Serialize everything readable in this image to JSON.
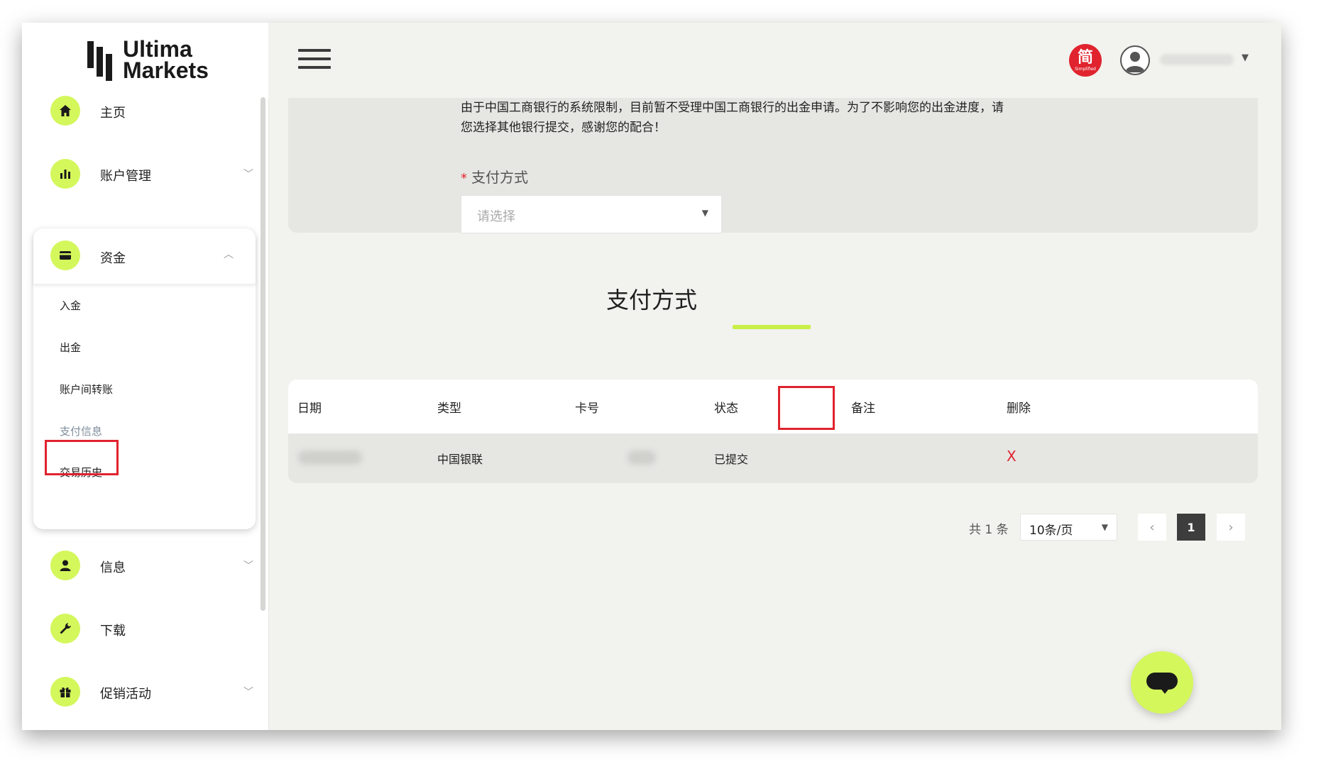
{
  "brand": {
    "line1": "Ultima",
    "line2": "Markets"
  },
  "sidebar": {
    "items": [
      {
        "label": "主页",
        "icon": "home-icon"
      },
      {
        "label": "账户管理",
        "icon": "bar-chart-icon"
      },
      {
        "label": "资金",
        "icon": "card-icon"
      },
      {
        "label": "信息",
        "icon": "user-icon"
      },
      {
        "label": "下载",
        "icon": "wrench-icon"
      },
      {
        "label": "促销活动",
        "icon": "gift-icon"
      }
    ],
    "funds_sub": [
      {
        "label": "入金"
      },
      {
        "label": "出金"
      },
      {
        "label": "账户间转账"
      },
      {
        "label": "支付信息",
        "active": true
      },
      {
        "label": "交易历史"
      }
    ]
  },
  "header": {
    "lang_badge": "简",
    "lang_badge_sub": "Simplified"
  },
  "form": {
    "notice_line1": "由于中国工商银行的系统限制，目前暂不受理中国工商银行的出金申请。为了不影响您的出金进度，请",
    "notice_line2": "您选择其他银行提交，感谢您的配合！",
    "required_mark": "*",
    "field_label": "支付方式",
    "select_placeholder": "请选择"
  },
  "section_title": "支付方式",
  "table": {
    "headers": [
      "日期",
      "类型",
      "卡号",
      "状态",
      "备注",
      "删除"
    ],
    "rows": [
      {
        "type": "中国银联",
        "status": "已提交",
        "remark": "",
        "delete": "X"
      }
    ]
  },
  "pagination": {
    "total": "共 1 条",
    "page_size": "10条/页",
    "current_page": "1",
    "prev": "‹",
    "next": "›"
  },
  "colors": {
    "accent": "#d4f75c",
    "highlight_box": "#e0232e",
    "background": "#f2f2ee"
  }
}
